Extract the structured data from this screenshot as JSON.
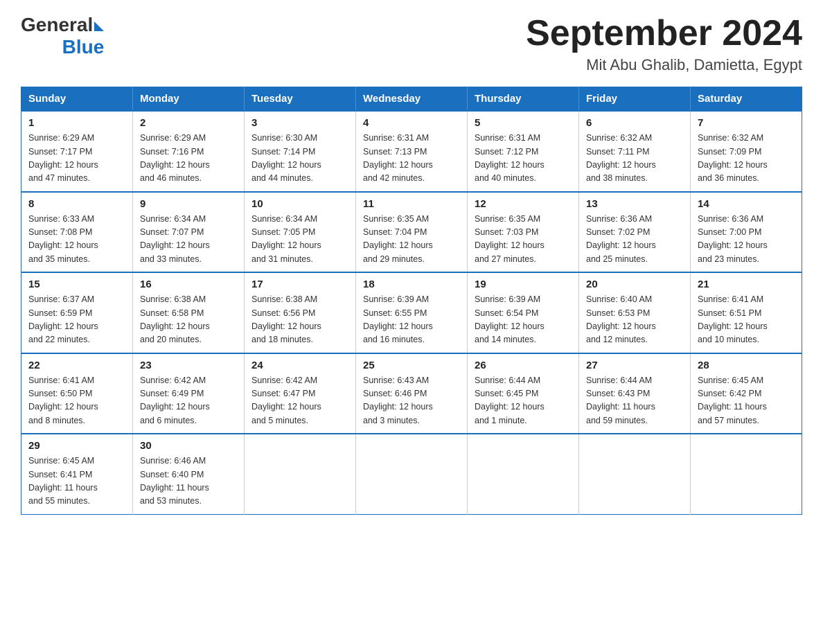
{
  "header": {
    "title": "September 2024",
    "subtitle": "Mit Abu Ghalib, Damietta, Egypt",
    "logo_general": "General",
    "logo_blue": "Blue"
  },
  "columns": [
    "Sunday",
    "Monday",
    "Tuesday",
    "Wednesday",
    "Thursday",
    "Friday",
    "Saturday"
  ],
  "weeks": [
    [
      {
        "day": "1",
        "info": "Sunrise: 6:29 AM\nSunset: 7:17 PM\nDaylight: 12 hours\nand 47 minutes."
      },
      {
        "day": "2",
        "info": "Sunrise: 6:29 AM\nSunset: 7:16 PM\nDaylight: 12 hours\nand 46 minutes."
      },
      {
        "day": "3",
        "info": "Sunrise: 6:30 AM\nSunset: 7:14 PM\nDaylight: 12 hours\nand 44 minutes."
      },
      {
        "day": "4",
        "info": "Sunrise: 6:31 AM\nSunset: 7:13 PM\nDaylight: 12 hours\nand 42 minutes."
      },
      {
        "day": "5",
        "info": "Sunrise: 6:31 AM\nSunset: 7:12 PM\nDaylight: 12 hours\nand 40 minutes."
      },
      {
        "day": "6",
        "info": "Sunrise: 6:32 AM\nSunset: 7:11 PM\nDaylight: 12 hours\nand 38 minutes."
      },
      {
        "day": "7",
        "info": "Sunrise: 6:32 AM\nSunset: 7:09 PM\nDaylight: 12 hours\nand 36 minutes."
      }
    ],
    [
      {
        "day": "8",
        "info": "Sunrise: 6:33 AM\nSunset: 7:08 PM\nDaylight: 12 hours\nand 35 minutes."
      },
      {
        "day": "9",
        "info": "Sunrise: 6:34 AM\nSunset: 7:07 PM\nDaylight: 12 hours\nand 33 minutes."
      },
      {
        "day": "10",
        "info": "Sunrise: 6:34 AM\nSunset: 7:05 PM\nDaylight: 12 hours\nand 31 minutes."
      },
      {
        "day": "11",
        "info": "Sunrise: 6:35 AM\nSunset: 7:04 PM\nDaylight: 12 hours\nand 29 minutes."
      },
      {
        "day": "12",
        "info": "Sunrise: 6:35 AM\nSunset: 7:03 PM\nDaylight: 12 hours\nand 27 minutes."
      },
      {
        "day": "13",
        "info": "Sunrise: 6:36 AM\nSunset: 7:02 PM\nDaylight: 12 hours\nand 25 minutes."
      },
      {
        "day": "14",
        "info": "Sunrise: 6:36 AM\nSunset: 7:00 PM\nDaylight: 12 hours\nand 23 minutes."
      }
    ],
    [
      {
        "day": "15",
        "info": "Sunrise: 6:37 AM\nSunset: 6:59 PM\nDaylight: 12 hours\nand 22 minutes."
      },
      {
        "day": "16",
        "info": "Sunrise: 6:38 AM\nSunset: 6:58 PM\nDaylight: 12 hours\nand 20 minutes."
      },
      {
        "day": "17",
        "info": "Sunrise: 6:38 AM\nSunset: 6:56 PM\nDaylight: 12 hours\nand 18 minutes."
      },
      {
        "day": "18",
        "info": "Sunrise: 6:39 AM\nSunset: 6:55 PM\nDaylight: 12 hours\nand 16 minutes."
      },
      {
        "day": "19",
        "info": "Sunrise: 6:39 AM\nSunset: 6:54 PM\nDaylight: 12 hours\nand 14 minutes."
      },
      {
        "day": "20",
        "info": "Sunrise: 6:40 AM\nSunset: 6:53 PM\nDaylight: 12 hours\nand 12 minutes."
      },
      {
        "day": "21",
        "info": "Sunrise: 6:41 AM\nSunset: 6:51 PM\nDaylight: 12 hours\nand 10 minutes."
      }
    ],
    [
      {
        "day": "22",
        "info": "Sunrise: 6:41 AM\nSunset: 6:50 PM\nDaylight: 12 hours\nand 8 minutes."
      },
      {
        "day": "23",
        "info": "Sunrise: 6:42 AM\nSunset: 6:49 PM\nDaylight: 12 hours\nand 6 minutes."
      },
      {
        "day": "24",
        "info": "Sunrise: 6:42 AM\nSunset: 6:47 PM\nDaylight: 12 hours\nand 5 minutes."
      },
      {
        "day": "25",
        "info": "Sunrise: 6:43 AM\nSunset: 6:46 PM\nDaylight: 12 hours\nand 3 minutes."
      },
      {
        "day": "26",
        "info": "Sunrise: 6:44 AM\nSunset: 6:45 PM\nDaylight: 12 hours\nand 1 minute."
      },
      {
        "day": "27",
        "info": "Sunrise: 6:44 AM\nSunset: 6:43 PM\nDaylight: 11 hours\nand 59 minutes."
      },
      {
        "day": "28",
        "info": "Sunrise: 6:45 AM\nSunset: 6:42 PM\nDaylight: 11 hours\nand 57 minutes."
      }
    ],
    [
      {
        "day": "29",
        "info": "Sunrise: 6:45 AM\nSunset: 6:41 PM\nDaylight: 11 hours\nand 55 minutes."
      },
      {
        "day": "30",
        "info": "Sunrise: 6:46 AM\nSunset: 6:40 PM\nDaylight: 11 hours\nand 53 minutes."
      },
      null,
      null,
      null,
      null,
      null
    ]
  ]
}
